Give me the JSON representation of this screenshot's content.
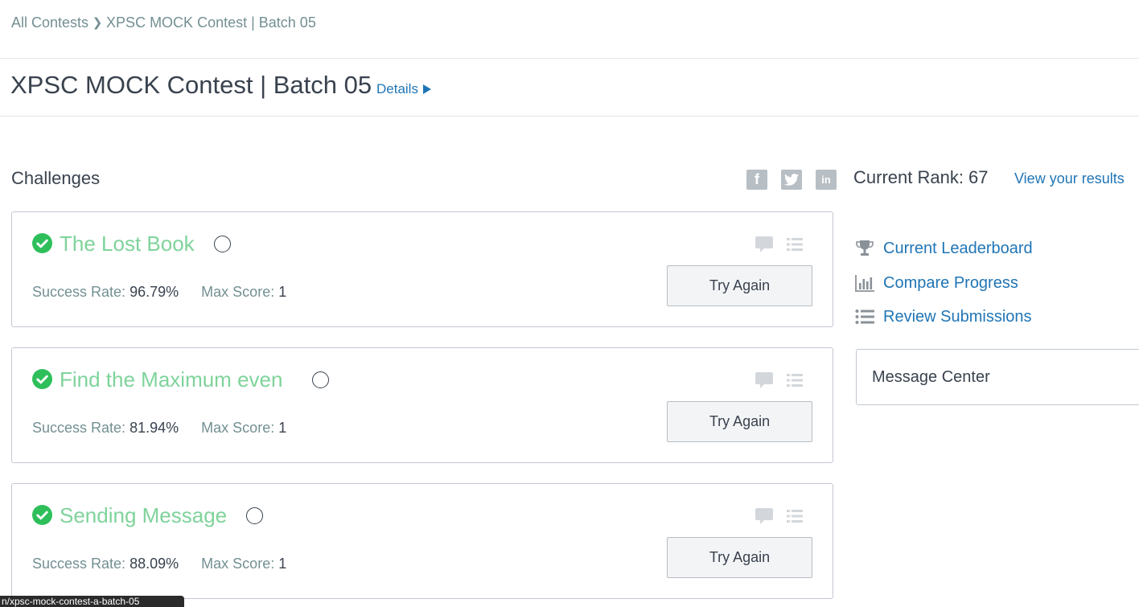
{
  "breadcrumb": {
    "items": [
      "All Contests",
      "XPSC MOCK Contest | Batch 05"
    ]
  },
  "contest": {
    "title": "XPSC MOCK Contest | Batch 05",
    "details_label": "Details"
  },
  "challenges_section": {
    "title": "Challenges",
    "success_rate_label": "Success Rate:",
    "max_score_label": "Max Score:",
    "button_label": "Try Again",
    "items": [
      {
        "title": "The Lost Book",
        "success_rate": "96.79%",
        "max_score": "1",
        "solved": true
      },
      {
        "title": "Find the Maximum even",
        "success_rate": "81.94%",
        "max_score": "1",
        "solved": true
      },
      {
        "title": "Sending Message",
        "success_rate": "88.09%",
        "max_score": "1",
        "solved": true
      }
    ]
  },
  "sidebar": {
    "current_rank": "Current Rank: 67",
    "view_results_label": "View your results",
    "links": [
      {
        "label": "Current Leaderboard",
        "icon": "trophy-icon"
      },
      {
        "label": "Compare Progress",
        "icon": "bar-chart-icon"
      },
      {
        "label": "Review Submissions",
        "icon": "list-icon"
      }
    ],
    "message_center_label": "Message Center"
  },
  "social": {
    "icons": [
      "facebook-icon",
      "twitter-icon",
      "linkedin-icon"
    ]
  },
  "status_bar": {
    "url_text": "n/xpsc-mock-contest-a-batch-05"
  },
  "colors": {
    "solved_title": "#7fd39b",
    "check_green": "#2ebf5b",
    "link_blue": "#1f75b6",
    "text_dark": "#39424e",
    "text_muted": "#738f93"
  }
}
